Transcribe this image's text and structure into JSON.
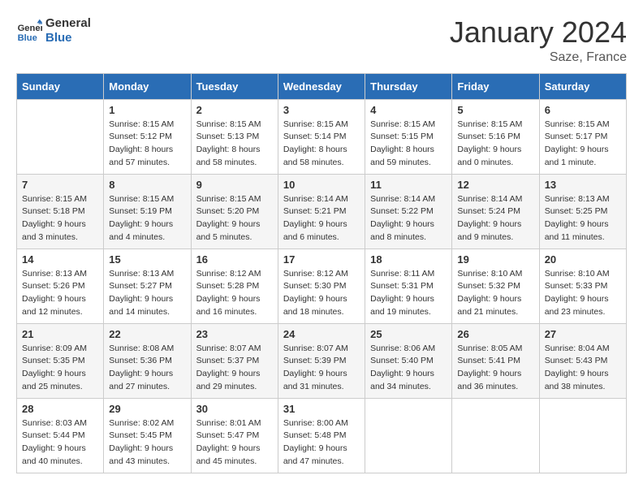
{
  "header": {
    "logo_line1": "General",
    "logo_line2": "Blue",
    "month_title": "January 2024",
    "location": "Saze, France"
  },
  "days_of_week": [
    "Sunday",
    "Monday",
    "Tuesday",
    "Wednesday",
    "Thursday",
    "Friday",
    "Saturday"
  ],
  "weeks": [
    [
      {
        "day": "",
        "sunrise": "",
        "sunset": "",
        "daylight": ""
      },
      {
        "day": "1",
        "sunrise": "Sunrise: 8:15 AM",
        "sunset": "Sunset: 5:12 PM",
        "daylight": "Daylight: 8 hours and 57 minutes."
      },
      {
        "day": "2",
        "sunrise": "Sunrise: 8:15 AM",
        "sunset": "Sunset: 5:13 PM",
        "daylight": "Daylight: 8 hours and 58 minutes."
      },
      {
        "day": "3",
        "sunrise": "Sunrise: 8:15 AM",
        "sunset": "Sunset: 5:14 PM",
        "daylight": "Daylight: 8 hours and 58 minutes."
      },
      {
        "day": "4",
        "sunrise": "Sunrise: 8:15 AM",
        "sunset": "Sunset: 5:15 PM",
        "daylight": "Daylight: 8 hours and 59 minutes."
      },
      {
        "day": "5",
        "sunrise": "Sunrise: 8:15 AM",
        "sunset": "Sunset: 5:16 PM",
        "daylight": "Daylight: 9 hours and 0 minutes."
      },
      {
        "day": "6",
        "sunrise": "Sunrise: 8:15 AM",
        "sunset": "Sunset: 5:17 PM",
        "daylight": "Daylight: 9 hours and 1 minute."
      }
    ],
    [
      {
        "day": "7",
        "sunrise": "Sunrise: 8:15 AM",
        "sunset": "Sunset: 5:18 PM",
        "daylight": "Daylight: 9 hours and 3 minutes."
      },
      {
        "day": "8",
        "sunrise": "Sunrise: 8:15 AM",
        "sunset": "Sunset: 5:19 PM",
        "daylight": "Daylight: 9 hours and 4 minutes."
      },
      {
        "day": "9",
        "sunrise": "Sunrise: 8:15 AM",
        "sunset": "Sunset: 5:20 PM",
        "daylight": "Daylight: 9 hours and 5 minutes."
      },
      {
        "day": "10",
        "sunrise": "Sunrise: 8:14 AM",
        "sunset": "Sunset: 5:21 PM",
        "daylight": "Daylight: 9 hours and 6 minutes."
      },
      {
        "day": "11",
        "sunrise": "Sunrise: 8:14 AM",
        "sunset": "Sunset: 5:22 PM",
        "daylight": "Daylight: 9 hours and 8 minutes."
      },
      {
        "day": "12",
        "sunrise": "Sunrise: 8:14 AM",
        "sunset": "Sunset: 5:24 PM",
        "daylight": "Daylight: 9 hours and 9 minutes."
      },
      {
        "day": "13",
        "sunrise": "Sunrise: 8:13 AM",
        "sunset": "Sunset: 5:25 PM",
        "daylight": "Daylight: 9 hours and 11 minutes."
      }
    ],
    [
      {
        "day": "14",
        "sunrise": "Sunrise: 8:13 AM",
        "sunset": "Sunset: 5:26 PM",
        "daylight": "Daylight: 9 hours and 12 minutes."
      },
      {
        "day": "15",
        "sunrise": "Sunrise: 8:13 AM",
        "sunset": "Sunset: 5:27 PM",
        "daylight": "Daylight: 9 hours and 14 minutes."
      },
      {
        "day": "16",
        "sunrise": "Sunrise: 8:12 AM",
        "sunset": "Sunset: 5:28 PM",
        "daylight": "Daylight: 9 hours and 16 minutes."
      },
      {
        "day": "17",
        "sunrise": "Sunrise: 8:12 AM",
        "sunset": "Sunset: 5:30 PM",
        "daylight": "Daylight: 9 hours and 18 minutes."
      },
      {
        "day": "18",
        "sunrise": "Sunrise: 8:11 AM",
        "sunset": "Sunset: 5:31 PM",
        "daylight": "Daylight: 9 hours and 19 minutes."
      },
      {
        "day": "19",
        "sunrise": "Sunrise: 8:10 AM",
        "sunset": "Sunset: 5:32 PM",
        "daylight": "Daylight: 9 hours and 21 minutes."
      },
      {
        "day": "20",
        "sunrise": "Sunrise: 8:10 AM",
        "sunset": "Sunset: 5:33 PM",
        "daylight": "Daylight: 9 hours and 23 minutes."
      }
    ],
    [
      {
        "day": "21",
        "sunrise": "Sunrise: 8:09 AM",
        "sunset": "Sunset: 5:35 PM",
        "daylight": "Daylight: 9 hours and 25 minutes."
      },
      {
        "day": "22",
        "sunrise": "Sunrise: 8:08 AM",
        "sunset": "Sunset: 5:36 PM",
        "daylight": "Daylight: 9 hours and 27 minutes."
      },
      {
        "day": "23",
        "sunrise": "Sunrise: 8:07 AM",
        "sunset": "Sunset: 5:37 PM",
        "daylight": "Daylight: 9 hours and 29 minutes."
      },
      {
        "day": "24",
        "sunrise": "Sunrise: 8:07 AM",
        "sunset": "Sunset: 5:39 PM",
        "daylight": "Daylight: 9 hours and 31 minutes."
      },
      {
        "day": "25",
        "sunrise": "Sunrise: 8:06 AM",
        "sunset": "Sunset: 5:40 PM",
        "daylight": "Daylight: 9 hours and 34 minutes."
      },
      {
        "day": "26",
        "sunrise": "Sunrise: 8:05 AM",
        "sunset": "Sunset: 5:41 PM",
        "daylight": "Daylight: 9 hours and 36 minutes."
      },
      {
        "day": "27",
        "sunrise": "Sunrise: 8:04 AM",
        "sunset": "Sunset: 5:43 PM",
        "daylight": "Daylight: 9 hours and 38 minutes."
      }
    ],
    [
      {
        "day": "28",
        "sunrise": "Sunrise: 8:03 AM",
        "sunset": "Sunset: 5:44 PM",
        "daylight": "Daylight: 9 hours and 40 minutes."
      },
      {
        "day": "29",
        "sunrise": "Sunrise: 8:02 AM",
        "sunset": "Sunset: 5:45 PM",
        "daylight": "Daylight: 9 hours and 43 minutes."
      },
      {
        "day": "30",
        "sunrise": "Sunrise: 8:01 AM",
        "sunset": "Sunset: 5:47 PM",
        "daylight": "Daylight: 9 hours and 45 minutes."
      },
      {
        "day": "31",
        "sunrise": "Sunrise: 8:00 AM",
        "sunset": "Sunset: 5:48 PM",
        "daylight": "Daylight: 9 hours and 47 minutes."
      },
      {
        "day": "",
        "sunrise": "",
        "sunset": "",
        "daylight": ""
      },
      {
        "day": "",
        "sunrise": "",
        "sunset": "",
        "daylight": ""
      },
      {
        "day": "",
        "sunrise": "",
        "sunset": "",
        "daylight": ""
      }
    ]
  ]
}
